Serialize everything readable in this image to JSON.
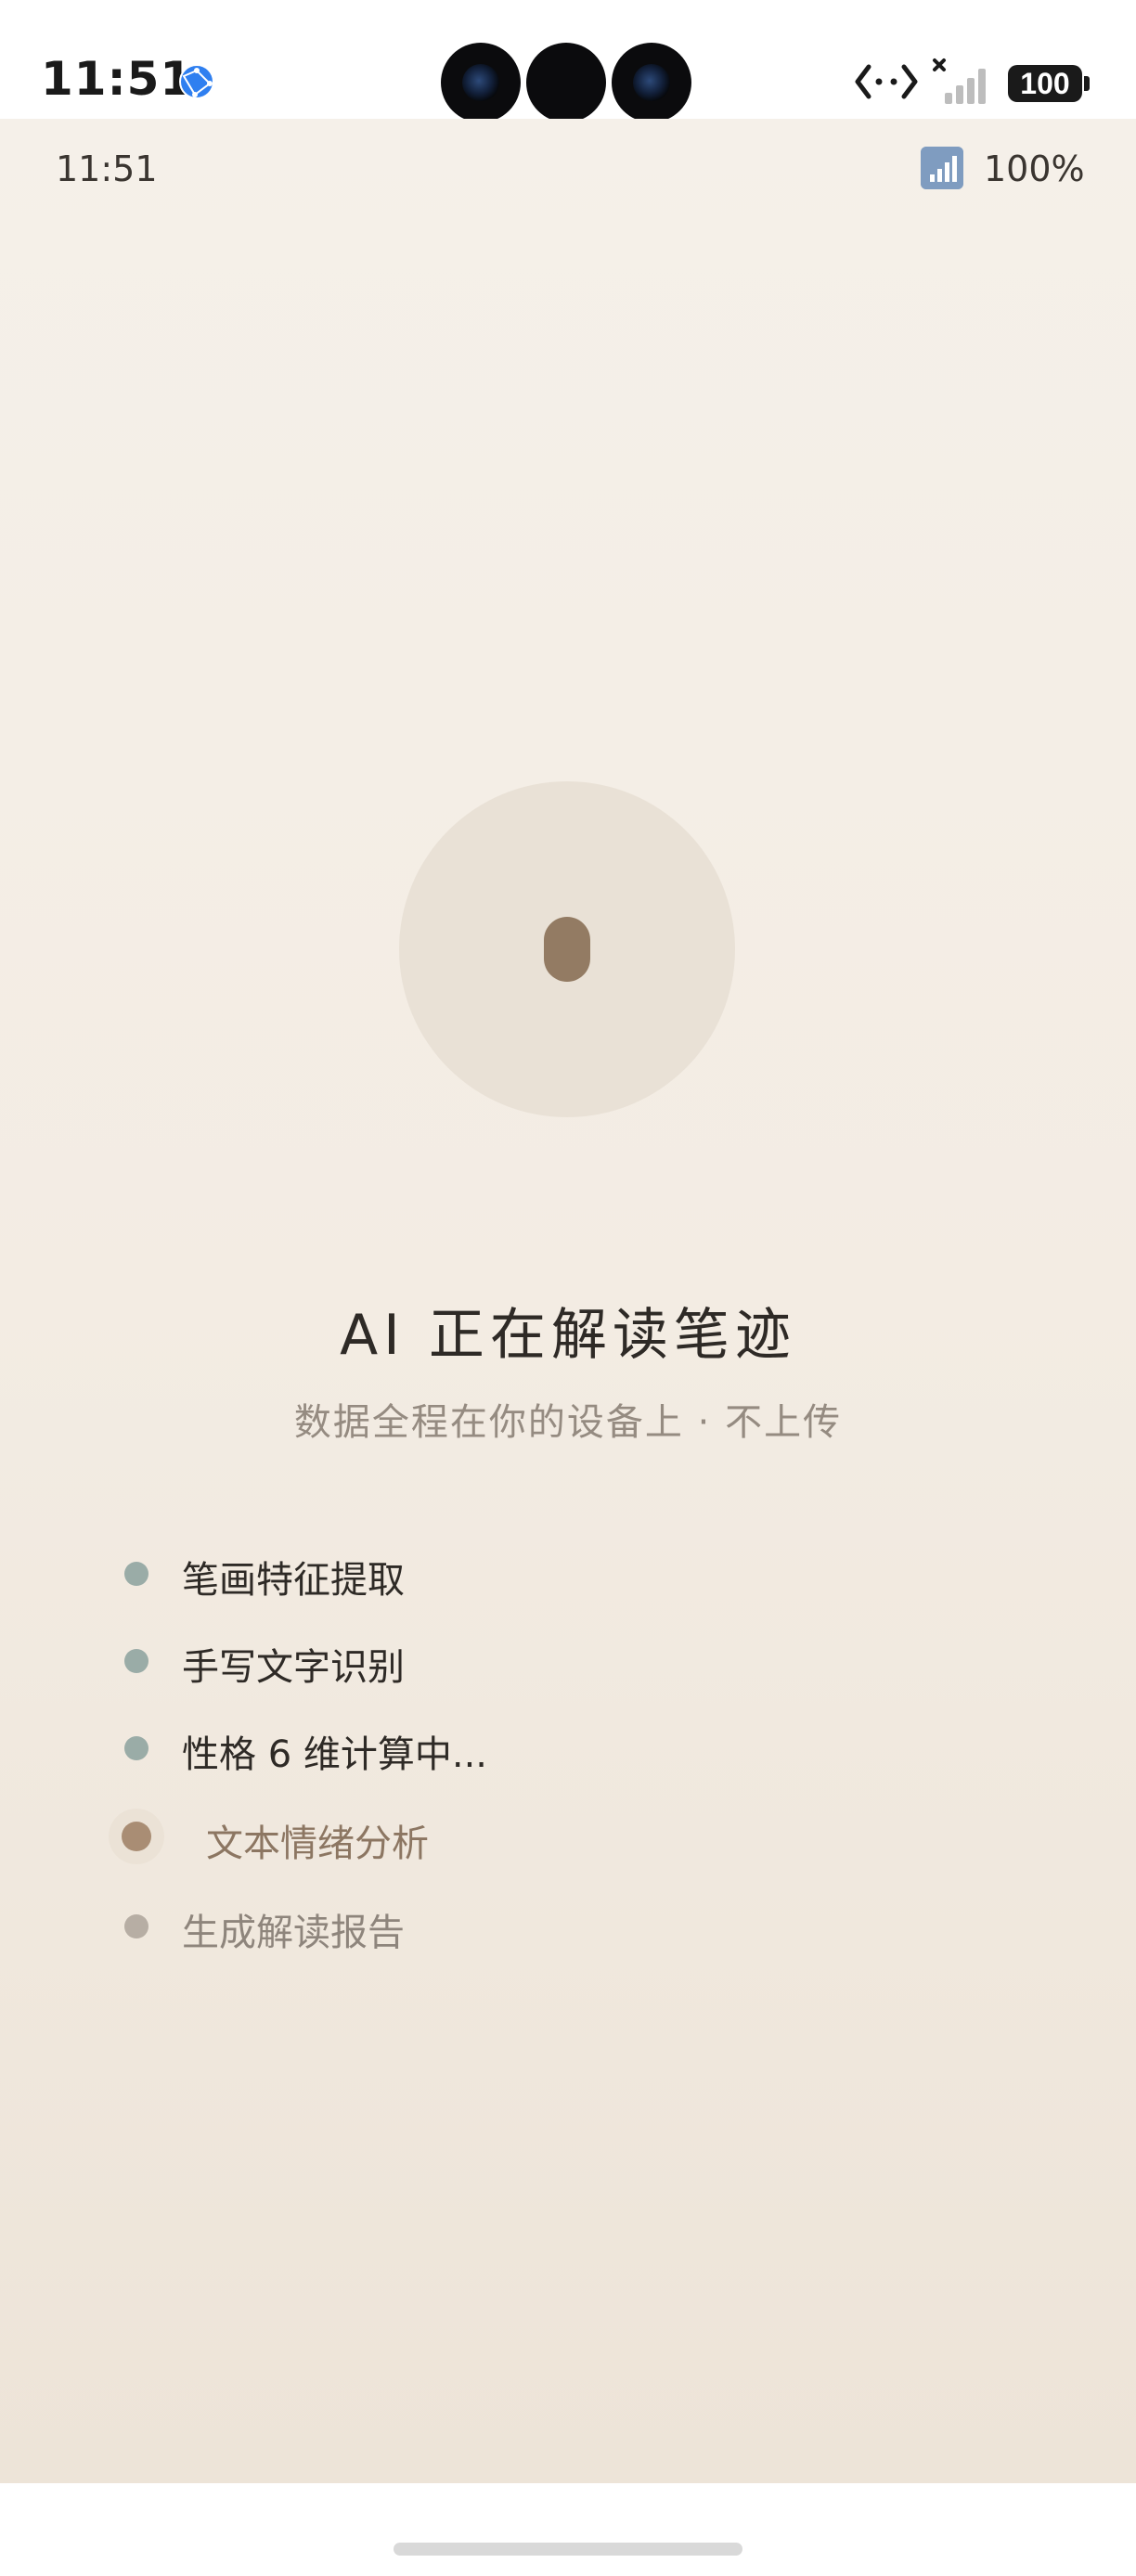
{
  "system_status": {
    "time": "11:51",
    "battery": "100",
    "icons": [
      "globe-icon",
      "data-transfer-icon",
      "no-signal-icon",
      "battery-icon"
    ]
  },
  "app_status": {
    "time": "11:51",
    "battery": "100%",
    "icons": [
      "signal-icon"
    ]
  },
  "loader": {
    "icon": "processing-indicator-icon"
  },
  "heading": {
    "title": "AI 正在解读笔迹",
    "subtitle": "数据全程在你的设备上 · 不上传"
  },
  "steps": [
    {
      "label": "笔画特征提取",
      "state": "done"
    },
    {
      "label": "手写文字识别",
      "state": "done"
    },
    {
      "label": "性格 6 维计算中...",
      "state": "done"
    },
    {
      "label": "文本情绪分析",
      "state": "active"
    },
    {
      "label": "生成解读报告",
      "state": "pending"
    }
  ],
  "colors": {
    "background_top": "#f5f0e9",
    "background_bottom": "#ede4d8",
    "accent_brown": "#937b63",
    "done_dot": "#9aaca7",
    "pending_dot": "#b7aea4"
  }
}
